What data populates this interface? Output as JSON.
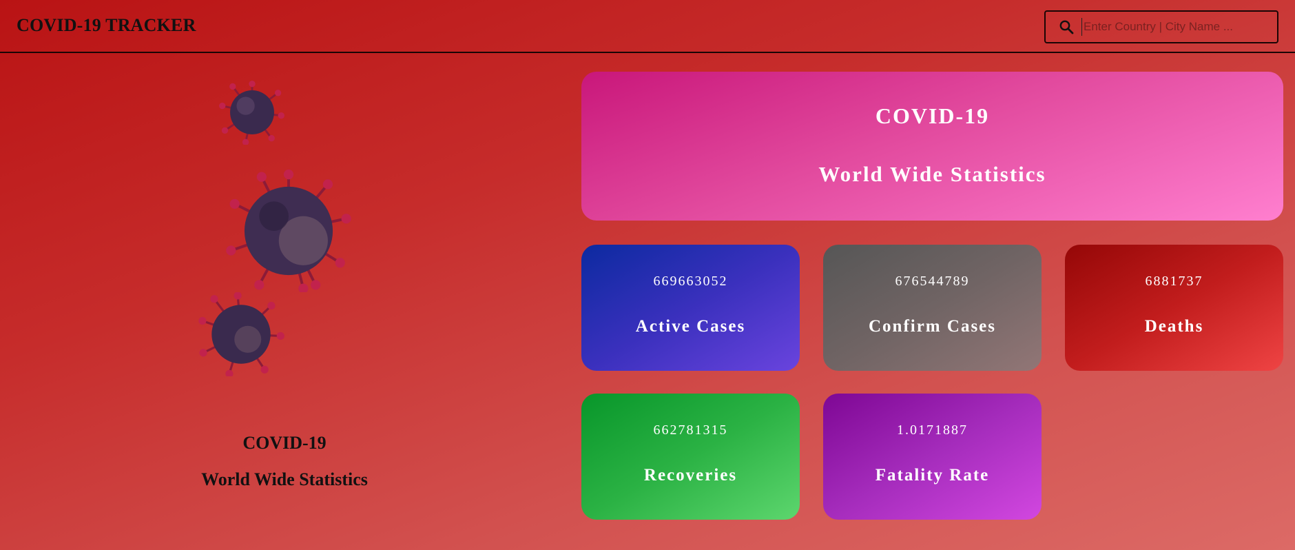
{
  "app": {
    "brand": "COVID-19 TRACKER"
  },
  "search": {
    "placeholder": "Enter Country | City Name ...",
    "value": "",
    "icon": "search-icon"
  },
  "left_panel": {
    "title": "COVID-19",
    "subtitle": "World Wide Statistics",
    "image": "coronavirus-illustration"
  },
  "hero": {
    "title": "COVID-19",
    "subtitle": "World Wide Statistics",
    "colors": [
      "#c9177a",
      "#ff7fcf"
    ]
  },
  "stats": [
    {
      "value": "669663052",
      "label": "Active Cases",
      "colors": [
        "#0c2aa0",
        "#6a44de"
      ]
    },
    {
      "value": "676544789",
      "label": "Confirm Cases",
      "colors": [
        "#565656",
        "#927676"
      ]
    },
    {
      "value": "6881737",
      "label": "Deaths",
      "colors": [
        "#950707",
        "#ef4444"
      ]
    },
    {
      "value": "662781315",
      "label": "Recoveries",
      "colors": [
        "#08962a",
        "#5dd66e"
      ]
    },
    {
      "value": "1.0171887",
      "label": "Fatality Rate",
      "colors": [
        "#7e0794",
        "#d247e0"
      ]
    }
  ],
  "theme": {
    "background": "#c62c2b"
  }
}
